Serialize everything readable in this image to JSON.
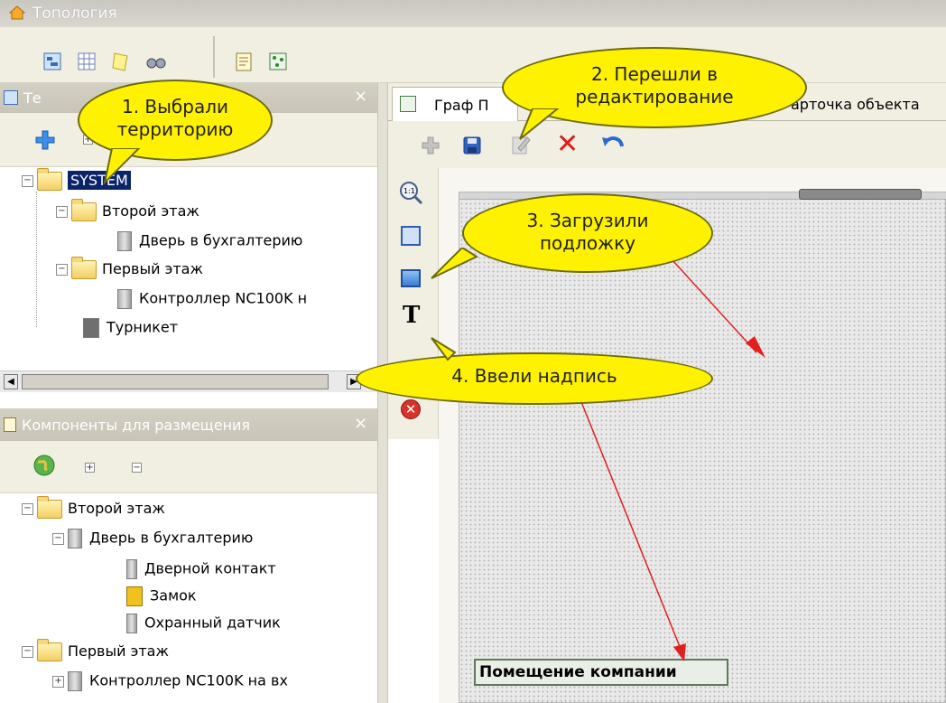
{
  "window": {
    "title": "Топология"
  },
  "territory_panel": {
    "title": "Те",
    "tree": [
      {
        "label": "SYSTEM",
        "selected": true
      },
      {
        "label": "Второй этаж"
      },
      {
        "label": "Дверь в бухгалтерию"
      },
      {
        "label": "Первый этаж"
      },
      {
        "label": "Контроллер NC100K н"
      },
      {
        "label": "Турникет"
      }
    ]
  },
  "components_panel": {
    "title": "Компоненты для размещения",
    "tree": [
      {
        "label": "Второй этаж"
      },
      {
        "label": "Дверь в бухгалтерию"
      },
      {
        "label": "Дверной контакт"
      },
      {
        "label": "Замок"
      },
      {
        "label": "Охранный датчик"
      },
      {
        "label": "Первый этаж"
      },
      {
        "label": "Контроллер NC100K на вх"
      }
    ]
  },
  "tabs": [
    {
      "label": "Граф П"
    },
    {
      "label": "арточка объекта"
    }
  ],
  "canvas": {
    "text_label": "Помещение компании",
    "text_tool_glyph": "T",
    "zoom_glyph": "1:1"
  },
  "callouts": [
    {
      "text": "1. Выбрали\nтерриторию"
    },
    {
      "text": "2. Перешли в\nредактирование"
    },
    {
      "text": "3. Загрузили\nподложку"
    },
    {
      "text": "4. Ввели надпись"
    }
  ],
  "colors": {
    "callout_fill": "#fff200",
    "arrow": "#e0201e",
    "selection": "#0a246a"
  }
}
